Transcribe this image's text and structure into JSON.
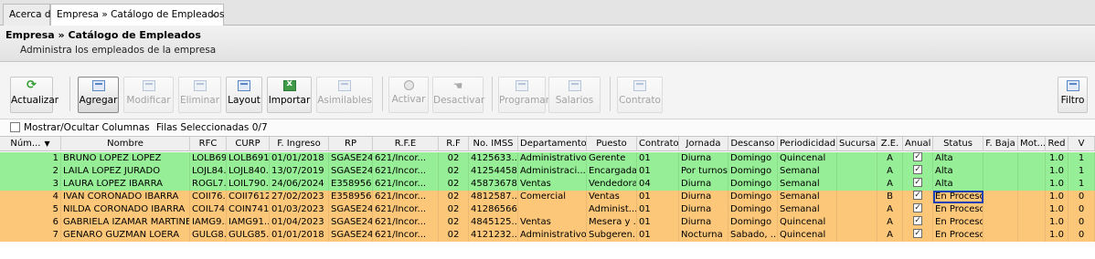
{
  "tabs": [
    {
      "label": "Acerca de"
    },
    {
      "label": "Empresa » Catálogo de Empleados",
      "close": "×"
    }
  ],
  "header": {
    "title": "Empresa » Catálogo de Empleados",
    "subtitle": "Administra los empleados de la empresa"
  },
  "toolbar": {
    "actualizar": "Actualizar",
    "agregar": "Agregar",
    "modificar": "Modificar",
    "eliminar": "Eliminar",
    "layout": "Layout",
    "importar": "Importar",
    "asimilables": "Asimilables",
    "activar": "Activar",
    "desactivar": "Desactivar",
    "programar": "Programar",
    "salarios": "Salarios",
    "contrato": "Contrato",
    "filtro": "Filtro"
  },
  "options": {
    "mostrar_columnas": "Mostrar/Ocultar Columnas",
    "filas_seleccionadas": "Filas Seleccionadas 0/7"
  },
  "grid": {
    "columns": [
      "Núm...",
      "Nombre",
      "RFC",
      "CURP",
      "F. Ingreso",
      "RP",
      "R.F.E",
      "R.F",
      "No. IMSS",
      "Departamento",
      "Puesto",
      "Contrato",
      "Jornada",
      "Descanso",
      "Periodicidad",
      "Sucursal",
      "Z.E.",
      "Anual",
      "Status",
      "F. Baja",
      "Mot...",
      "Red",
      "V"
    ],
    "sort_icon": "▼",
    "rows": [
      {
        "num": "1",
        "nombre": "BRUNO LOPEZ LOPEZ",
        "rfc": "LOLB69...",
        "curp": "LOLB691...",
        "fingreso": "01/01/2018",
        "rp": "SGASE24...",
        "rfe": "621/Incor...",
        "rf": "02",
        "imss": "4125633...",
        "depto": "Administrativo",
        "puesto": "Gerente",
        "contrato": "01",
        "jornada": "Diurna",
        "descanso": "Domingo",
        "periodicidad": "Quincenal",
        "sucursal": "",
        "ze": "A",
        "anual": "✓",
        "status": "Alta",
        "fbaja": "",
        "mot": "",
        "red": "1.0",
        "v": "1",
        "color": "green"
      },
      {
        "num": "2",
        "nombre": "LAILA LOPEZ JURADO",
        "rfc": "LOJL84...",
        "curp": "LOJL840...",
        "fingreso": "13/07/2019",
        "rp": "SGASE24...",
        "rfe": "621/Incor...",
        "rf": "02",
        "imss": "412544584",
        "depto": "Administraci...",
        "puesto": "Encargada",
        "contrato": "01",
        "jornada": "Por turnos",
        "descanso": "Domingo",
        "periodicidad": "Semanal",
        "sucursal": "",
        "ze": "A",
        "anual": "✓",
        "status": "Alta",
        "fbaja": "",
        "mot": "",
        "red": "1.0",
        "v": "1",
        "color": "green"
      },
      {
        "num": "3",
        "nombre": "LAURA LOPEZ IBARRA",
        "rfc": "ROGL7...",
        "curp": "LOIL790...",
        "fingreso": "24/06/2024",
        "rp": "E358956...",
        "rfe": "621/Incor...",
        "rf": "02",
        "imss": "45873678",
        "depto": "Ventas",
        "puesto": "Vendedora",
        "contrato": "04",
        "jornada": "Diurna",
        "descanso": "Domingo",
        "periodicidad": "Semanal",
        "sucursal": "",
        "ze": "A",
        "anual": "✓",
        "status": "Alta",
        "fbaja": "",
        "mot": "",
        "red": "1.0",
        "v": "1",
        "color": "green"
      },
      {
        "num": "4",
        "nombre": "IVAN CORONADO IBARRA",
        "rfc": "COII76...",
        "curp": "COII7612...",
        "fingreso": "27/02/2023",
        "rp": "E358956...",
        "rfe": "621/Incor...",
        "rf": "02",
        "imss": "4812587...",
        "depto": "Comercial",
        "puesto": "Ventas",
        "contrato": "01",
        "jornada": "Diurna",
        "descanso": "Domingo",
        "periodicidad": "Semanal",
        "sucursal": "",
        "ze": "B",
        "anual": "✓",
        "status": "En Proceso",
        "fbaja": "",
        "mot": "",
        "red": "1.0",
        "v": "0",
        "color": "orange",
        "focus": true
      },
      {
        "num": "5",
        "nombre": "NILDA CORONADO IBARRA",
        "rfc": "COIL74...",
        "curp": "COIN741...",
        "fingreso": "01/03/2023",
        "rp": "SGASE24...",
        "rfe": "621/Incor...",
        "rf": "02",
        "imss": "412865667",
        "depto": "",
        "puesto": "Administ...",
        "contrato": "01",
        "jornada": "Diurna",
        "descanso": "Domingo",
        "periodicidad": "Semanal",
        "sucursal": "",
        "ze": "A",
        "anual": "✓",
        "status": "En Proceso",
        "fbaja": "",
        "mot": "",
        "red": "1.0",
        "v": "0",
        "color": "orange"
      },
      {
        "num": "6",
        "nombre": "GABRIELA IZAMAR MARTINEZ",
        "rfc": "IAMG9...",
        "curp": "IAMG91...",
        "fingreso": "01/04/2023",
        "rp": "SGASE24...",
        "rfe": "621/Incor...",
        "rf": "02",
        "imss": "4845125...",
        "depto": "Ventas",
        "puesto": "Mesera y ...",
        "contrato": "01",
        "jornada": "Diurna",
        "descanso": "Domingo",
        "periodicidad": "Quincenal",
        "sucursal": "",
        "ze": "A",
        "anual": "✓",
        "status": "En Proceso",
        "fbaja": "",
        "mot": "",
        "red": "1.0",
        "v": "0",
        "color": "orange"
      },
      {
        "num": "7",
        "nombre": "GENARO GUZMAN LOERA",
        "rfc": "GULG8...",
        "curp": "GULG85...",
        "fingreso": "01/01/2018",
        "rp": "SGASE24...",
        "rfe": "621/Incor...",
        "rf": "02",
        "imss": "4121232...",
        "depto": "Administrativo",
        "puesto": "Subgeren...",
        "contrato": "01",
        "jornada": "Nocturna",
        "descanso": "Sabado, ...",
        "periodicidad": "Quincenal",
        "sucursal": "",
        "ze": "A",
        "anual": "✓",
        "status": "En Proceso",
        "fbaja": "",
        "mot": "",
        "red": "1.0",
        "v": "0",
        "color": "orange"
      }
    ]
  }
}
